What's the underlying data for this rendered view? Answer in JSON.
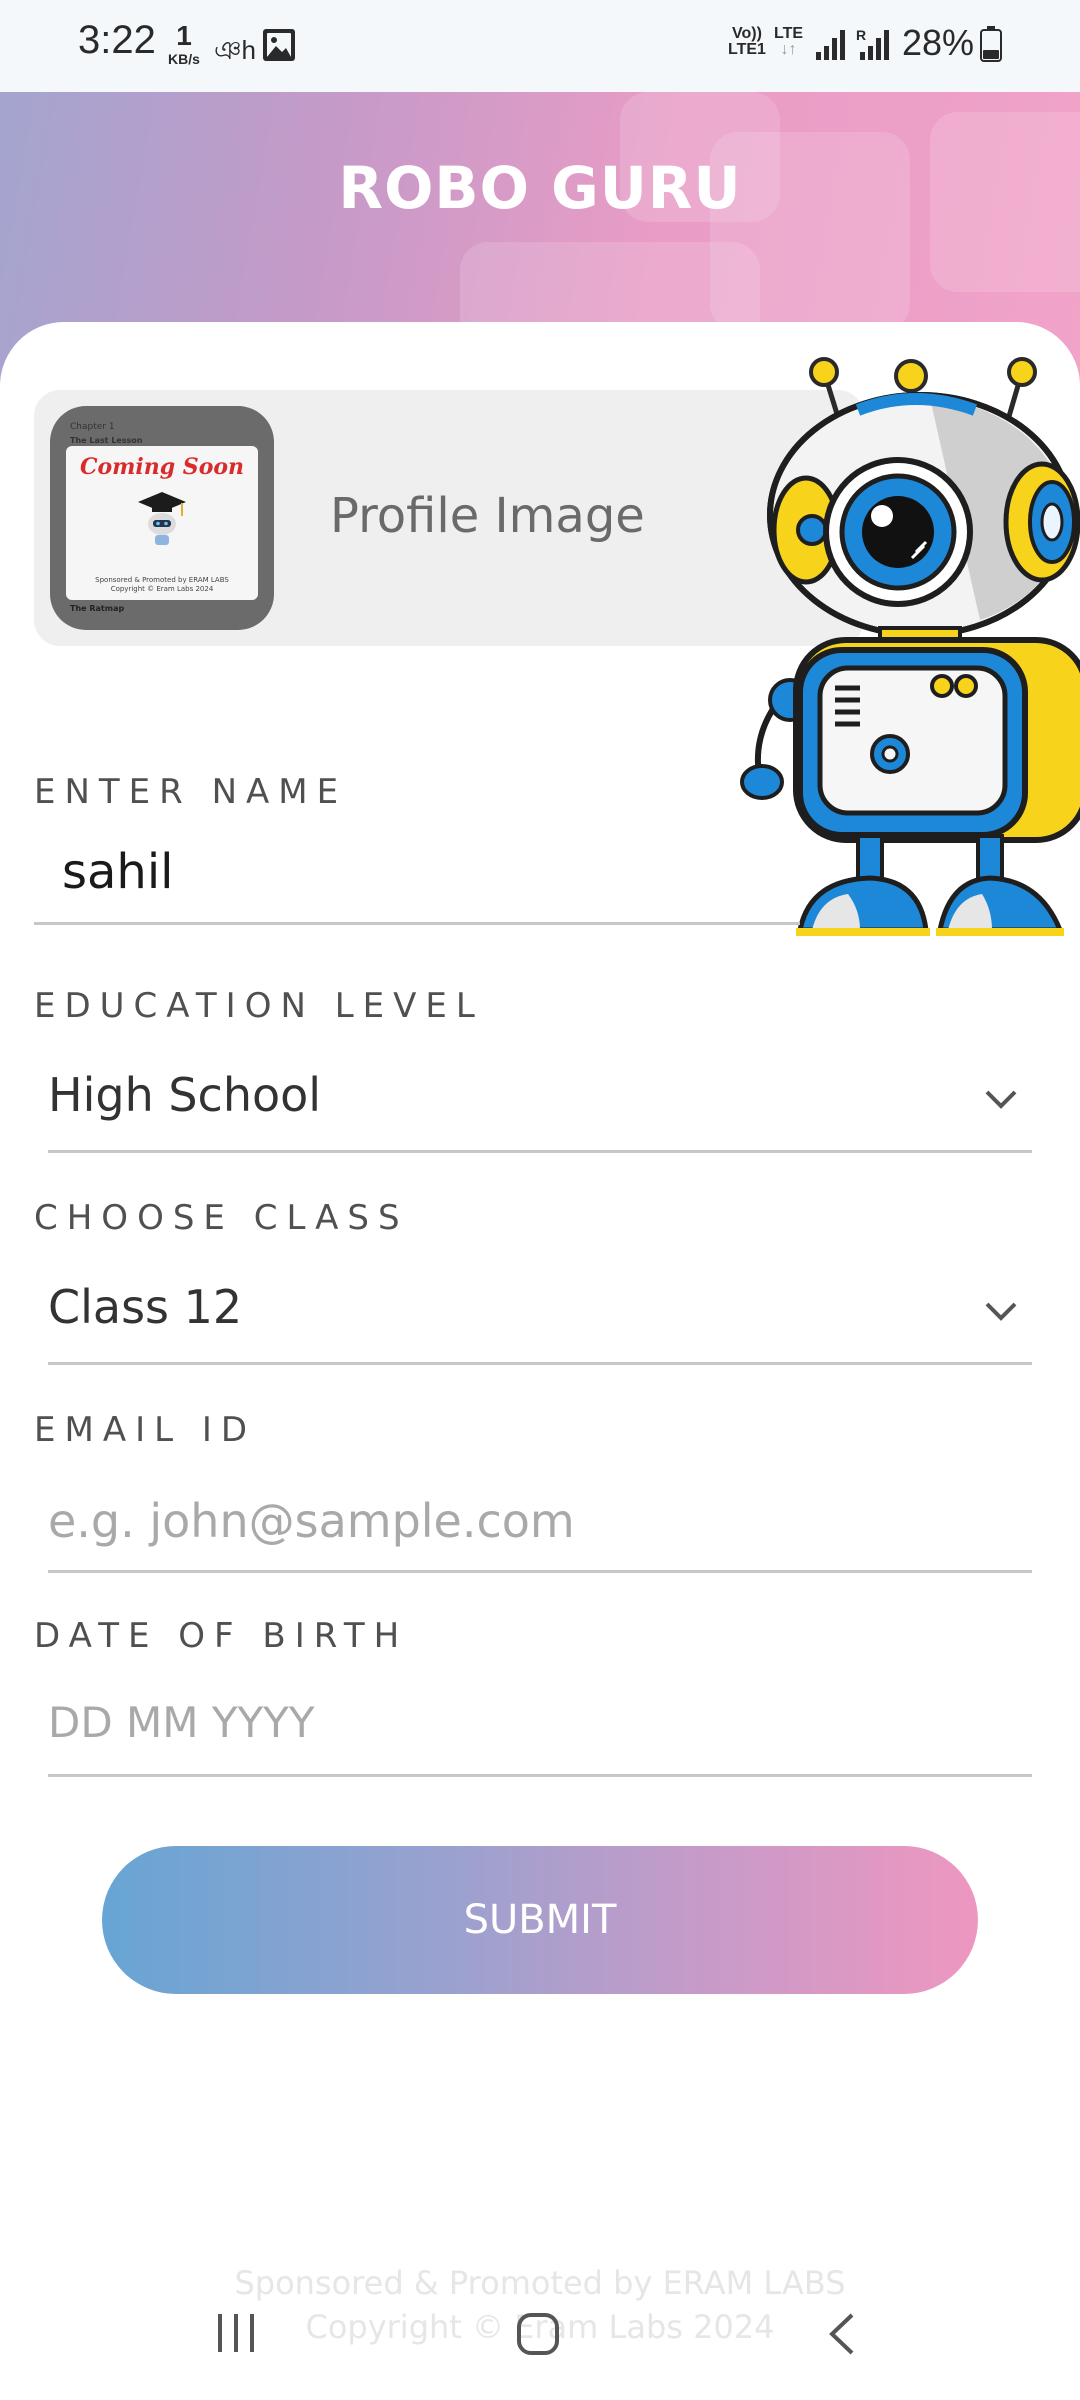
{
  "status_bar": {
    "time": "3:22",
    "net_speed_value": "1",
    "net_speed_unit": "KB/s",
    "notification_glyph": "ঞh",
    "volte_line1": "Vo))",
    "volte_line2": "LTE1",
    "lte_line1": "LTE",
    "lte_line2": "↓↑",
    "battery_percent": "28%",
    "icons": [
      "image-icon",
      "signal-icon",
      "signal-roaming-icon",
      "battery-icon"
    ]
  },
  "header": {
    "title": "ROBO GURU"
  },
  "profile": {
    "label": "Profile Image",
    "thumbnail": {
      "top_text": "Chapter 1",
      "sub_text": "The Last Lesson",
      "headline": "Coming Soon",
      "footer_line1": "Sponsored & Promoted by ERAM LABS",
      "footer_line2": "Copyright © Eram Labs 2024",
      "bottom_text": "The Ratmap"
    }
  },
  "form": {
    "name": {
      "label": "ENTER NAME",
      "value": "sahil"
    },
    "education": {
      "label": "EDUCATION LEVEL",
      "selected": "High School"
    },
    "class": {
      "label": "CHOOSE CLASS",
      "selected": "Class 12"
    },
    "email": {
      "label": "EMAIL ID",
      "placeholder": "e.g. john@sample.com"
    },
    "dob": {
      "label": "DATE OF BIRTH",
      "placeholder": "DD MM YYYY"
    },
    "submit_label": "SUBMIT"
  },
  "footer": {
    "line1": "Sponsored & Promoted by ERAM LABS",
    "line2": "Copyright © Eram Labs 2024"
  },
  "colors": {
    "header_gradient_start": "#a3a5cf",
    "header_gradient_end": "#f1a3c8",
    "submit_gradient_start": "#67a5d4",
    "submit_gradient_end": "#ee97c0",
    "robot_blue": "#1e88d8",
    "robot_yellow": "#f7d31c"
  }
}
